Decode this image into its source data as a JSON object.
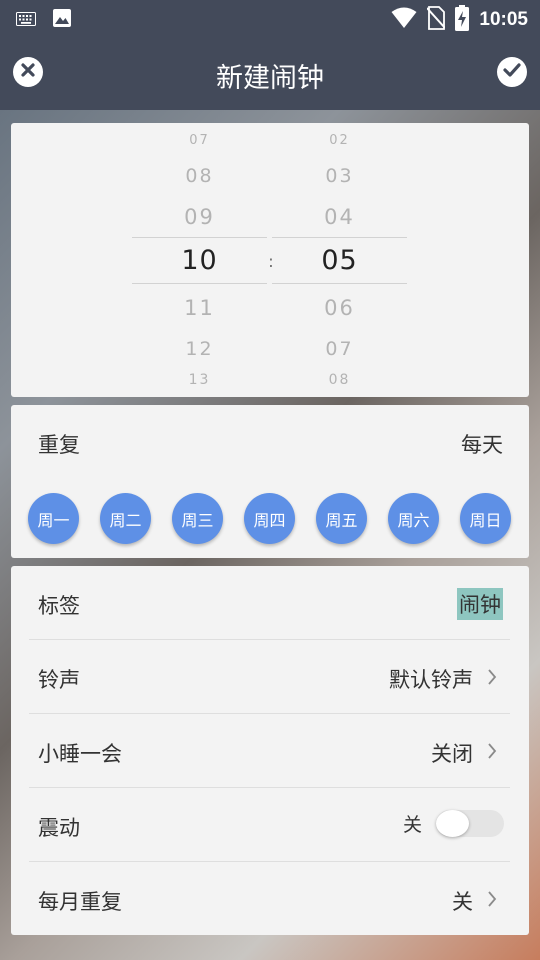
{
  "status_bar": {
    "time": "10:05",
    "icons": [
      "keyboard-icon",
      "image-icon",
      "wifi-icon",
      "no-sim-icon",
      "battery-charging-icon"
    ]
  },
  "app_bar": {
    "title": "新建闹钟",
    "close_icon": "close-circle-icon",
    "confirm_icon": "check-circle-icon"
  },
  "time_picker": {
    "hours": [
      "07",
      "08",
      "09",
      "10",
      "11",
      "12",
      "13"
    ],
    "minutes": [
      "02",
      "03",
      "04",
      "05",
      "06",
      "07",
      "08"
    ],
    "selected_hour": "10",
    "selected_minute": "05",
    "separator": ":"
  },
  "repeat": {
    "label": "重复",
    "value": "每天",
    "days": [
      "周一",
      "周二",
      "周三",
      "周四",
      "周五",
      "周六",
      "周日"
    ]
  },
  "settings": {
    "tag": {
      "label": "标签",
      "value": "闹钟"
    },
    "ringtone": {
      "label": "铃声",
      "value": "默认铃声"
    },
    "snooze": {
      "label": "小睡一会",
      "value": "关闭"
    },
    "vibrate": {
      "label": "震动",
      "value": "关",
      "on": false
    },
    "monthly_repeat": {
      "label": "每月重复",
      "value": "关"
    }
  },
  "colors": {
    "app_bar": "#434a5a",
    "day_button": "#5e90e6",
    "tag_highlight": "#8ec6c0"
  }
}
